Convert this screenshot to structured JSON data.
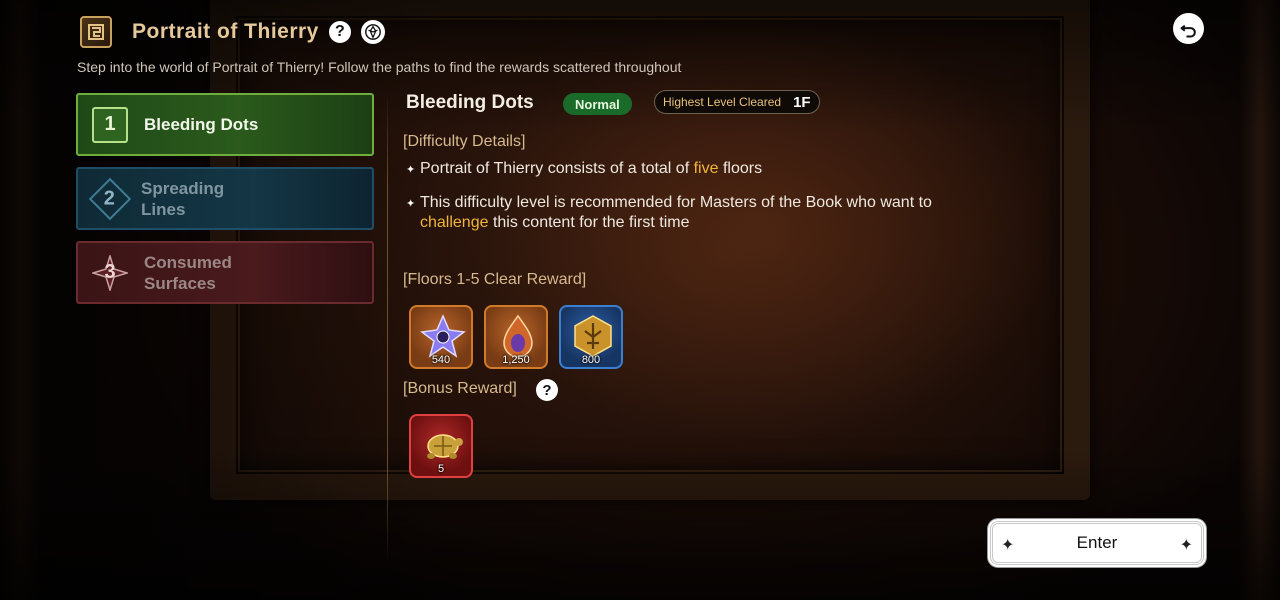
{
  "header": {
    "title": "Portrait of Thierry",
    "subtitle": "Step into the world of Portrait of Thierry! Follow the paths to find the rewards scattered throughout"
  },
  "tabs": [
    {
      "number": "1",
      "label_line1": "Bleeding Dots",
      "label_line2": "",
      "state": "selected"
    },
    {
      "number": "2",
      "label_line1": "Spreading",
      "label_line2": "Lines",
      "state": "unselected"
    },
    {
      "number": "3",
      "label_line1": "Consumed",
      "label_line2": "Surfaces",
      "state": "unselected"
    }
  ],
  "stage": {
    "title": "Bleeding Dots",
    "difficulty": "Normal",
    "highest_level_label": "Highest Level Cleared",
    "highest_level_value": "1F"
  },
  "details": {
    "heading": "[Difficulty Details]",
    "bullet1_pre": "Portrait of Thierry consists of a total of ",
    "bullet1_hl": "five",
    "bullet1_post": " floors",
    "bullet2_line1": "This difficulty level is recommended for Masters of the Book who want to",
    "bullet2_hl": "challenge",
    "bullet2_post": " this content for the first time"
  },
  "clear_reward": {
    "heading": "[Floors 1-5 Clear Reward]",
    "items": [
      {
        "icon": "crystal-star-icon",
        "count": "540"
      },
      {
        "icon": "flame-gem-icon",
        "count": "1,250"
      },
      {
        "icon": "gold-emblem-icon",
        "count": "800"
      }
    ]
  },
  "bonus_reward": {
    "heading": "[Bonus Reward]",
    "items": [
      {
        "icon": "gold-turtle-icon",
        "count": "5"
      }
    ]
  },
  "enter_label": "Enter",
  "colors": {
    "selected_tab": "#2b5a1c",
    "highlight": "#f0b53a",
    "difficulty_badge": "#1a6b2a"
  }
}
